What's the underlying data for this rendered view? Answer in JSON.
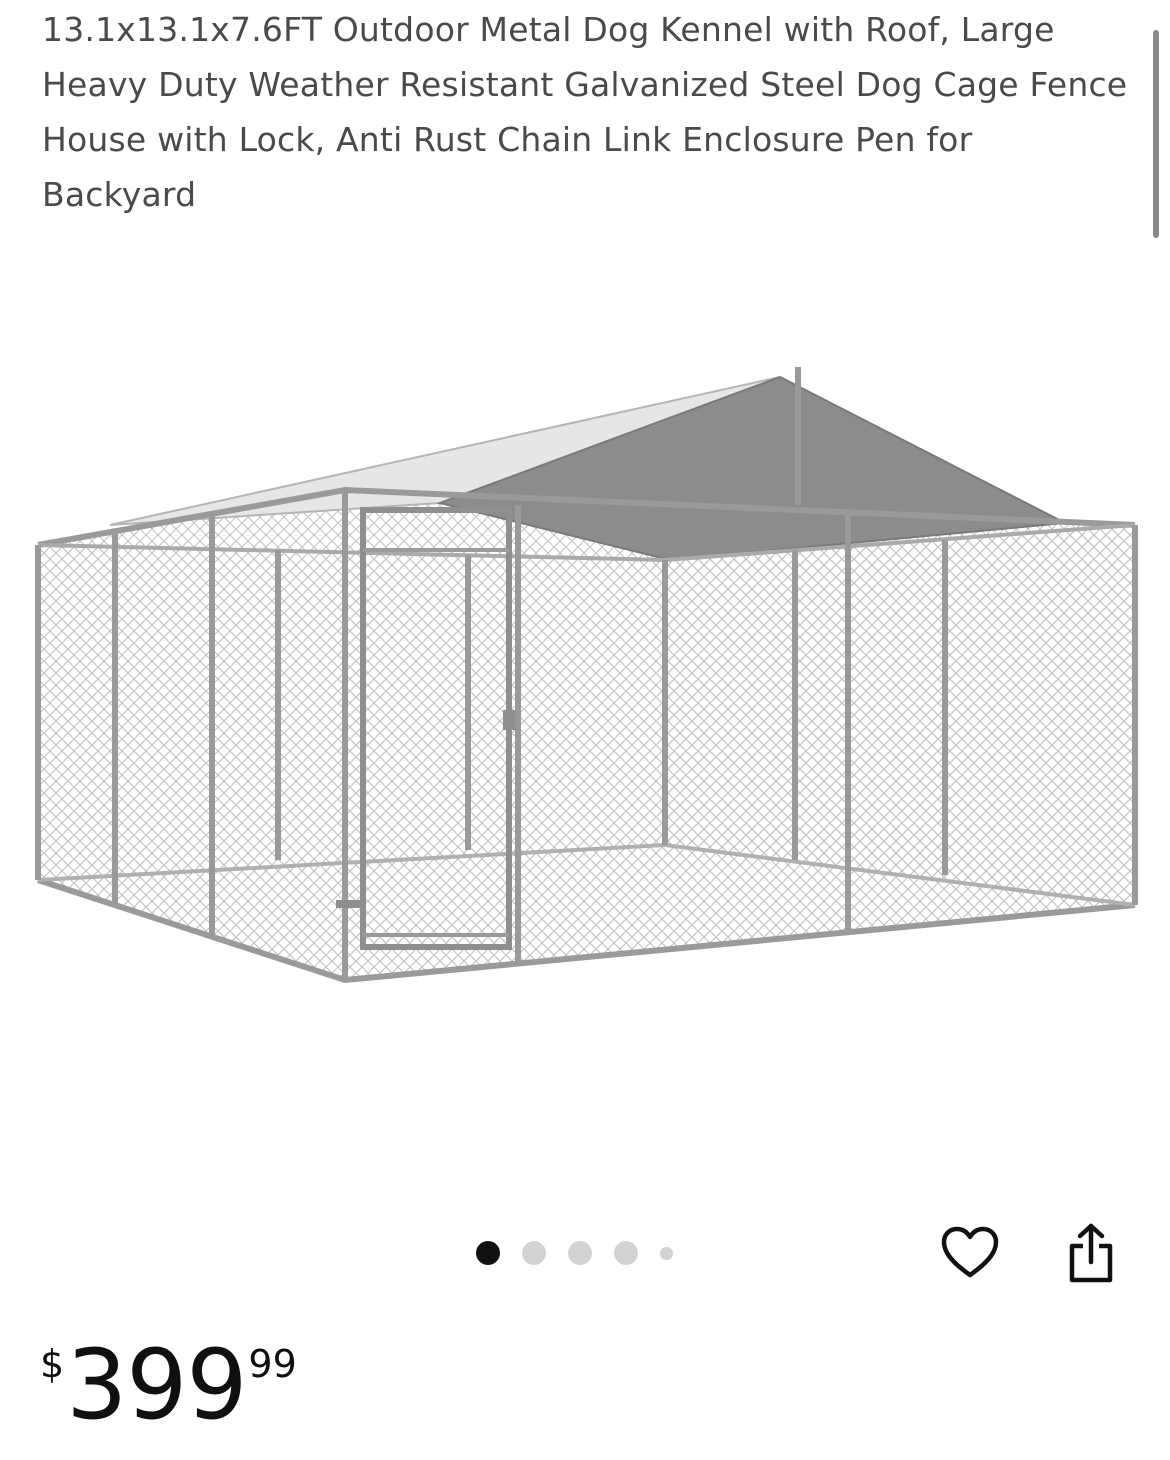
{
  "product": {
    "title": "13.1x13.1x7.6FT Outdoor Metal Dog Kennel with Roof, Large Heavy Duty Weather Resistant Galvanized Steel Dog Cage Fence House with Lock, Anti Rust Chain Link Enclosure Pen for Backyard",
    "image": {
      "icon": "dog-kennel-product-image",
      "roof_color": "#8c8c8c",
      "frame_color": "#9a9a9a"
    }
  },
  "gallery": {
    "total_images": 5,
    "active_index": 0
  },
  "actions": {
    "wishlist_icon": "heart-icon",
    "share_icon": "share-icon"
  },
  "price": {
    "symbol": "$",
    "whole": "399",
    "fraction": "99"
  }
}
